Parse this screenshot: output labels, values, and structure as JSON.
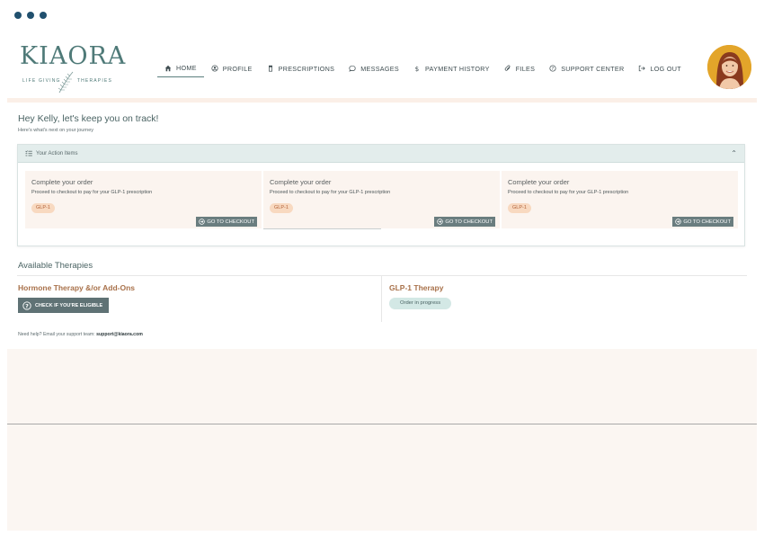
{
  "brand": {
    "name": "KIAORA",
    "tagline_left": "LIFE GIVING",
    "tagline_right": "THERAPIES"
  },
  "nav": {
    "items": [
      {
        "label": "HOME",
        "icon": "home-icon"
      },
      {
        "label": "PROFILE",
        "icon": "profile-icon"
      },
      {
        "label": "PRESCRIPTIONS",
        "icon": "prescription-bottle-icon"
      },
      {
        "label": "MESSAGES",
        "icon": "chat-bubble-icon"
      },
      {
        "label": "PAYMENT HISTORY",
        "icon": "dollar-icon"
      },
      {
        "label": "FILES",
        "icon": "paperclip-icon"
      },
      {
        "label": "SUPPORT CENTER",
        "icon": "help-circle-icon"
      },
      {
        "label": "LOG OUT",
        "icon": "logout-icon"
      }
    ],
    "active": "HOME"
  },
  "greeting": {
    "title": "Hey Kelly, let's keep you on track!",
    "subtitle": "Here's what's next on your journey"
  },
  "action_items": {
    "header": "Your Action Items",
    "cards": [
      {
        "title": "Complete your order",
        "description": "Proceed to checkout to pay for your GLP-1 prescription",
        "badge": "GLP-1",
        "button": "GO TO CHECKOUT"
      },
      {
        "title": "Complete your order",
        "description": "Proceed to checkout to pay for your GLP-1 prescription",
        "badge": "GLP-1",
        "button": "GO TO CHECKOUT"
      },
      {
        "title": "Complete your order",
        "description": "Proceed to checkout to pay for your GLP-1 prescription",
        "badge": "GLP-1",
        "button": "GO TO CHECKOUT"
      }
    ]
  },
  "therapies": {
    "title": "Available Therapies",
    "hormone": {
      "title": "Hormone Therapy &/or Add-Ons",
      "button": "CHECK IF YOU'RE ELIGIBLE"
    },
    "glp1": {
      "title": "GLP-1 Therapy",
      "status": "Order in progress"
    }
  },
  "help": {
    "text": "Need help? Email your support team: ",
    "email": "support@kiaora.com"
  },
  "colors": {
    "accent": "#5b7f7d",
    "window_dots": "#21506e",
    "badge_bg": "#f8d9c0",
    "badge_text": "#b3633a",
    "therapy_title": "#a8714a",
    "avatar_bg": "#e3a52a"
  }
}
